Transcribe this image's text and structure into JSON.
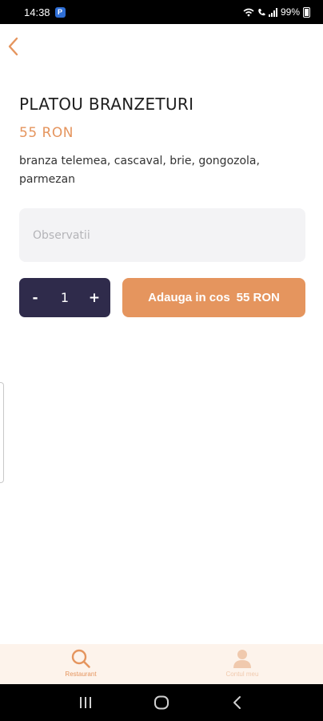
{
  "status_bar": {
    "time": "14:38",
    "app_icon": "P",
    "battery_percent": "99%"
  },
  "product": {
    "title": "PLATOU BRANZETURI",
    "price": "55 RON",
    "description": "branza telemea, cascaval, brie, gongozola, parmezan"
  },
  "notes": {
    "placeholder": "Observatii",
    "value": ""
  },
  "quantity": {
    "minus_label": "-",
    "value": "1",
    "plus_label": "+"
  },
  "add_to_cart": {
    "label": "Adauga in cos",
    "price": "55 RON"
  },
  "tab_bar": {
    "tabs": [
      {
        "label": "Restaurant",
        "icon": "search-icon",
        "active": true
      },
      {
        "label": "Contul meu",
        "icon": "user-icon",
        "active": false
      }
    ]
  },
  "colors": {
    "accent": "#e5955e",
    "stepper_bg": "#2f2b4b",
    "field_bg": "#f3f3f5",
    "tab_bar_bg": "#fdf3eb"
  }
}
